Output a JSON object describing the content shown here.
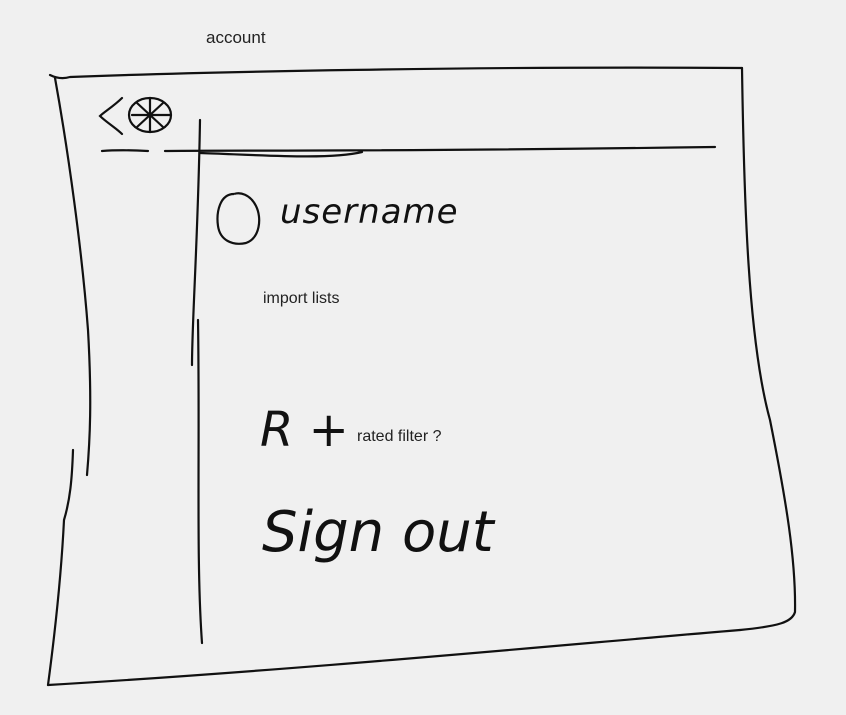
{
  "page": {
    "title": "account"
  },
  "header": {
    "back_icon": "chevron-left-icon",
    "settings_icon": "gear-icon"
  },
  "profile": {
    "avatar_icon": "avatar-circle",
    "username": "username"
  },
  "menu": {
    "import_lists": "import lists",
    "r_rated_symbol": "R +",
    "rated_filter": "rated filter ?",
    "sign_out": "Sign out"
  },
  "colors": {
    "background": "#f0f0f0",
    "ink": "#111111"
  }
}
